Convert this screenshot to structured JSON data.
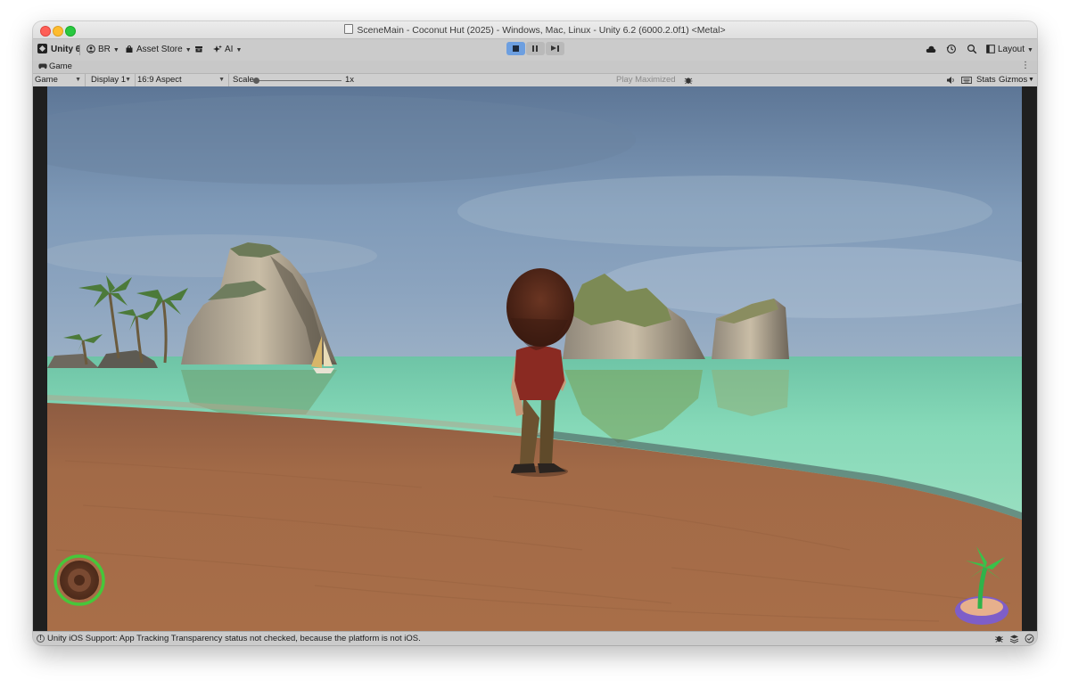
{
  "window": {
    "title": "SceneMain - Coconut Hut (2025) - Windows, Mac, Linux - Unity 6.2 (6000.2.0f1) <Metal>"
  },
  "toolbar": {
    "unity_label": "Unity 6",
    "account_label": "BR",
    "asset_store_label": "Asset Store",
    "ai_label": "AI",
    "layout_label": "Layout"
  },
  "tab": {
    "label": "Game"
  },
  "game_controls": {
    "view_select": "Game",
    "display_select": "Display 1",
    "aspect_select": "16:9 Aspect",
    "scale_label": "Scale",
    "scale_value": "1x",
    "play_mode_select": "Play Maximized",
    "stats_label": "Stats",
    "gizmos_label": "Gizmos"
  },
  "status": {
    "message": "Unity iOS Support: App Tracking Transparency status not checked, because the platform is not iOS."
  },
  "colors": {
    "play_active": "#6d9fe0",
    "sky_top": "#5d7898",
    "sea": "#7fd5b3",
    "sand": "#a56c48",
    "gear_ring": "#46c73a"
  }
}
